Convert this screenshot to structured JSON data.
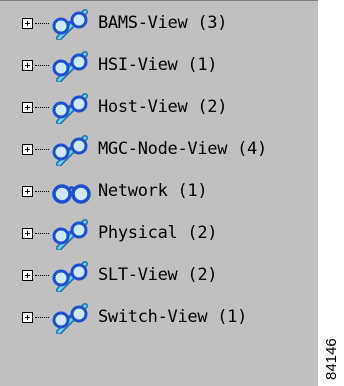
{
  "tree": {
    "items": [
      {
        "label": "BAMS-View (3)",
        "icon": "glasses-pencil-icon"
      },
      {
        "label": "HSI-View (1)",
        "icon": "glasses-pencil-icon"
      },
      {
        "label": "Host-View (2)",
        "icon": "glasses-pencil-icon"
      },
      {
        "label": "MGC-Node-View (4)",
        "icon": "glasses-pencil-icon"
      },
      {
        "label": "Network (1)",
        "icon": "glasses-icon"
      },
      {
        "label": "Physical (2)",
        "icon": "glasses-pencil-icon"
      },
      {
        "label": "SLT-View (2)",
        "icon": "glasses-pencil-icon"
      },
      {
        "label": "Switch-View (1)",
        "icon": "glasses-pencil-icon"
      }
    ]
  },
  "figure_id": "84146",
  "colors": {
    "panel": "#c0c0c0",
    "lens": "#1f6fd1",
    "pencil": "#2aa9c9"
  }
}
